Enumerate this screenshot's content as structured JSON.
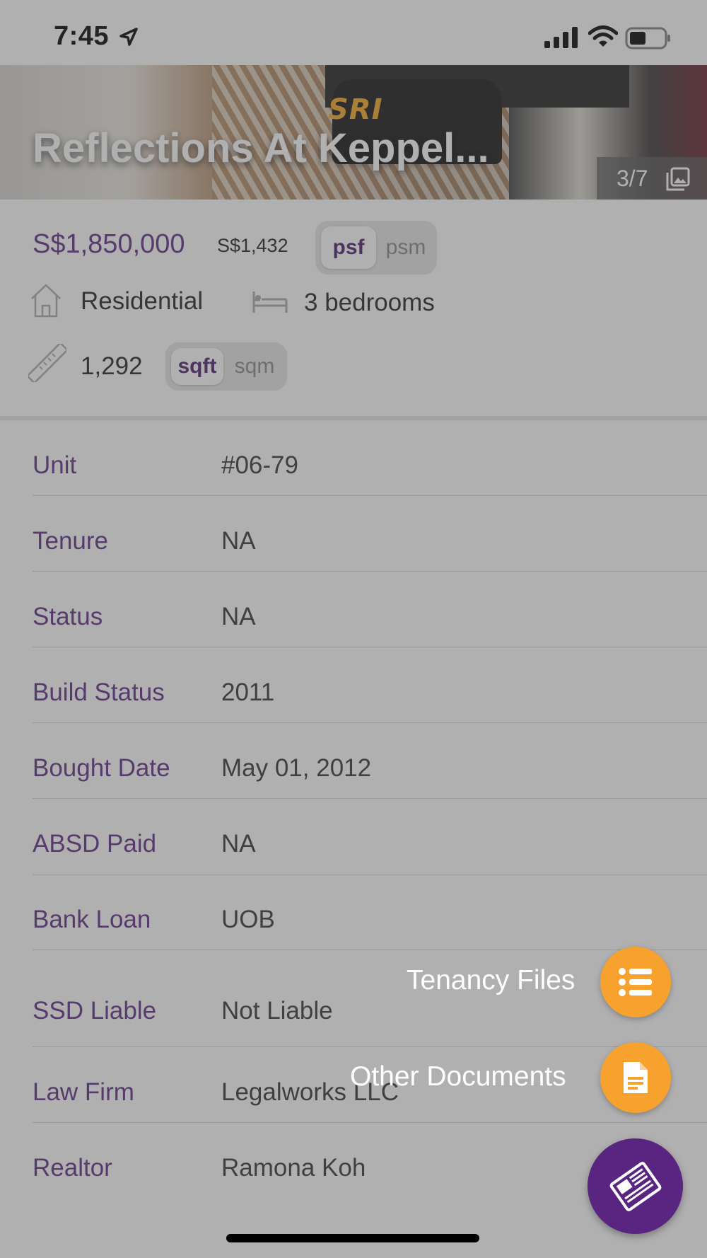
{
  "status_bar": {
    "time": "7:45"
  },
  "hero": {
    "title": "Reflections At Keppel...",
    "logo_text": "SRI",
    "photo_counter": "3/7"
  },
  "summary": {
    "price": "S$1,850,000",
    "price_per_area": "S$1,432",
    "price_unit_options": [
      "psf",
      "psm"
    ],
    "price_unit_selected": "psf",
    "property_type": "Residential",
    "bedrooms": "3 bedrooms",
    "area": "1,292",
    "area_unit_options": [
      "sqft",
      "sqm"
    ],
    "area_unit_selected": "sqft"
  },
  "details": [
    {
      "label": "Unit",
      "value": "#06-79"
    },
    {
      "label": "Tenure",
      "value": "NA"
    },
    {
      "label": "Status",
      "value": "NA"
    },
    {
      "label": "Build Status",
      "value": "2011"
    },
    {
      "label": "Bought Date",
      "value": "May 01, 2012"
    },
    {
      "label": "ABSD Paid",
      "value": "NA"
    },
    {
      "label": "Bank Loan",
      "value": "UOB"
    },
    {
      "label": "SSD Liable",
      "value": "Not Liable"
    },
    {
      "label": "Law Firm",
      "value": "Legalworks LLC"
    },
    {
      "label": "Realtor",
      "value": "Ramona Koh"
    }
  ],
  "fab_menu": {
    "tenancy_files": "Tenancy Files",
    "other_documents": "Other Documents"
  },
  "colors": {
    "accent": "#5e2b84",
    "fab_orange": "#f7a12e",
    "fab_main": "#5a2580"
  }
}
